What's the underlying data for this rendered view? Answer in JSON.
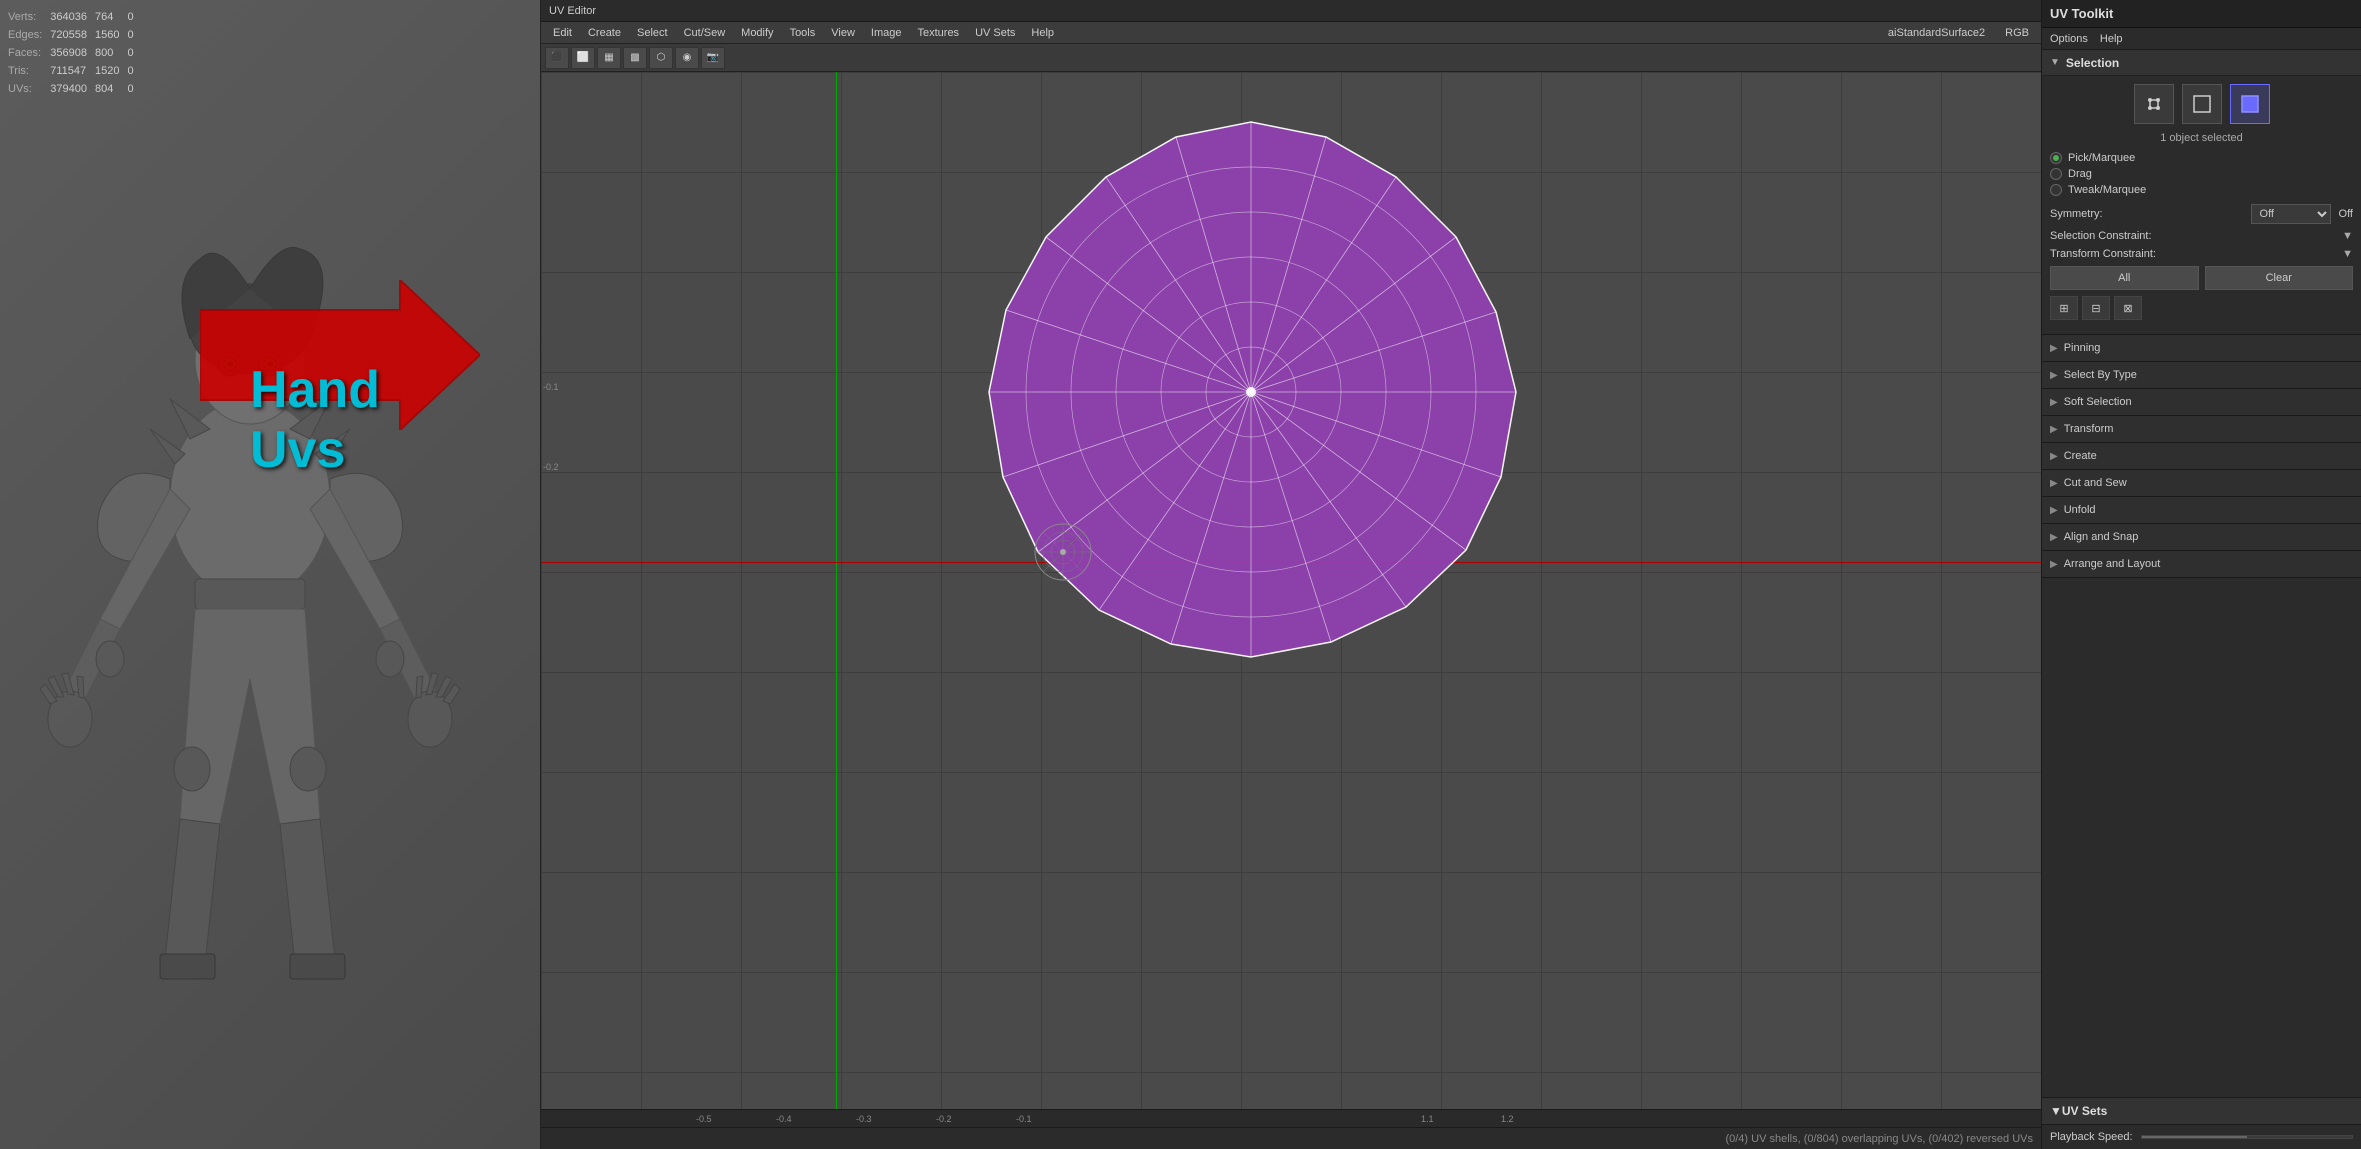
{
  "app": {
    "title": "UV Editor",
    "toolkit_title": "UV Toolkit"
  },
  "viewport_stats": {
    "verts_label": "Verts:",
    "verts_count": "364036",
    "verts_extra": "764",
    "edges_label": "Edges:",
    "edges_count": "720558",
    "edges_extra": "1560",
    "faces_label": "Faces:",
    "faces_count": "356908",
    "faces_extra": "800",
    "tris_label": "Tris:",
    "tris_count": "711547",
    "tris_extra": "1520",
    "uvs_label": "UVs:",
    "uvs_count": "379400",
    "uvs_extra": "804"
  },
  "annotation": {
    "text": "Hand Uvs"
  },
  "uv_editor": {
    "title": "UV Editor",
    "menu_items": [
      "Edit",
      "Create",
      "Select",
      "Cut/Sew",
      "Modify",
      "Tools",
      "View",
      "Image",
      "Textures",
      "UV Sets",
      "Help"
    ],
    "material_name": "aiStandardSurface2",
    "color_mode": "RGB",
    "status_bar": "(0/4) UV shells, (0/804) overlapping UVs, (0/402) reversed UVs"
  },
  "ruler": {
    "marks": [
      "-0.5",
      "-0.4",
      "-0.3",
      "-0.2",
      "-0.1",
      "",
      "1.1",
      "1.2"
    ],
    "v_marks": [
      "-0.1",
      "-0.2"
    ]
  },
  "right_panel": {
    "toolkit_title": "UV Toolkit",
    "options_label": "Options",
    "help_label": "Help",
    "selection_title": "Selection",
    "object_selected": "1 object selected",
    "selection_modes": {
      "pick_marquee": "Pick/Marquee",
      "drag": "Drag",
      "tweak_marquee": "Tweak/Marquee"
    },
    "symmetry_label": "Symmetry:",
    "symmetry_value": "Off",
    "selection_constraint_label": "Selection Constraint:",
    "transform_constraint_label": "Transform Constraint:",
    "all_button": "All",
    "clear_button": "Clear",
    "sections": [
      {
        "id": "pinning",
        "label": "Pinning",
        "expanded": false
      },
      {
        "id": "select-by-type",
        "label": "Select By Type",
        "expanded": false
      },
      {
        "id": "soft-selection",
        "label": "Soft Selection",
        "expanded": false
      },
      {
        "id": "transform",
        "label": "Transform",
        "expanded": false
      },
      {
        "id": "create",
        "label": "Create",
        "expanded": false
      },
      {
        "id": "cut-and-sew",
        "label": "Cut and Sew",
        "expanded": false
      },
      {
        "id": "unfold",
        "label": "Unfold",
        "expanded": false
      },
      {
        "id": "align-and-snap",
        "label": "Align and Snap",
        "expanded": false
      },
      {
        "id": "arrange-and-layout",
        "label": "Arrange and Layout",
        "expanded": false
      }
    ],
    "uv_sets_title": "UV Sets",
    "playback_speed_label": "Playback Speed:"
  }
}
